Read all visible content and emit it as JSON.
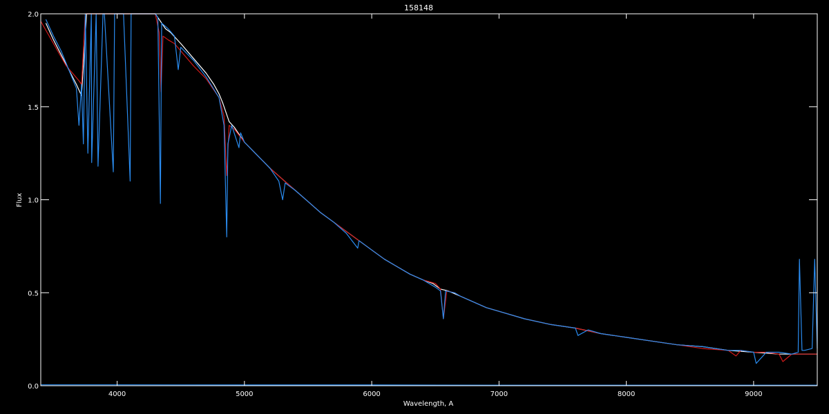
{
  "chart_data": {
    "type": "line",
    "title": "158148",
    "xlabel": "Wavelength, A",
    "ylabel": "Flux",
    "xlim": [
      3400,
      9500
    ],
    "ylim": [
      0.0,
      2.0
    ],
    "x_ticks": [
      4000,
      5000,
      6000,
      7000,
      8000,
      9000
    ],
    "x_tick_labels": [
      "4000",
      "5000",
      "6000",
      "7000",
      "8000",
      "9000"
    ],
    "y_ticks": [
      0.0,
      0.5,
      1.0,
      1.5,
      2.0
    ],
    "y_tick_labels": [
      "0.0",
      "0.5",
      "1.0",
      "1.5",
      "2.0"
    ],
    "grid": false,
    "series": [
      {
        "color": "#ffffff",
        "x": [
          3440,
          3500,
          3560,
          3620,
          3680,
          3720,
          3760,
          3800,
          3850,
          3900,
          3950,
          4000,
          4050,
          4100,
          4150,
          4200,
          4260,
          4300,
          4330,
          4380,
          4420,
          4500,
          4600,
          4700,
          4760,
          4800,
          4830,
          4880,
          4920,
          5000,
          5100,
          5200,
          5300,
          5400,
          5500,
          5600,
          5700,
          5800,
          5900,
          6000,
          6100,
          6200,
          6300,
          6400,
          6480,
          6540,
          6600,
          6700,
          6800,
          6900,
          7000,
          7200,
          7400,
          7600,
          7800,
          8000,
          8200,
          8400,
          8600,
          8800,
          9000,
          9200,
          9400,
          9500
        ],
        "y": [
          1.95,
          1.86,
          1.78,
          1.7,
          1.62,
          1.56,
          2.0,
          2.0,
          2.0,
          2.0,
          2.0,
          2.0,
          2.0,
          2.0,
          2.0,
          2.0,
          2.0,
          2.0,
          1.97,
          1.92,
          1.9,
          1.84,
          1.76,
          1.68,
          1.62,
          1.57,
          1.52,
          1.42,
          1.39,
          1.31,
          1.24,
          1.17,
          1.11,
          1.05,
          0.99,
          0.93,
          0.88,
          0.83,
          0.78,
          0.73,
          0.68,
          0.64,
          0.6,
          0.57,
          0.55,
          0.52,
          0.51,
          0.48,
          0.45,
          0.42,
          0.4,
          0.36,
          0.33,
          0.31,
          0.28,
          0.26,
          0.24,
          0.22,
          0.21,
          0.19,
          0.18,
          0.17,
          0.17,
          0.17
        ]
      },
      {
        "color": "#d21a1a",
        "x": [
          3400,
          3450,
          3500,
          3550,
          3600,
          3650,
          3700,
          3720,
          3750,
          3800,
          3850,
          3900,
          3970,
          4000,
          4050,
          4100,
          4150,
          4200,
          4250,
          4300,
          4330,
          4345,
          4360,
          4400,
          4450,
          4500,
          4600,
          4700,
          4800,
          4840,
          4861,
          4880,
          4920,
          5000,
          5100,
          5200,
          5300,
          5400,
          5500,
          5600,
          5700,
          5800,
          5900,
          6000,
          6100,
          6200,
          6300,
          6400,
          6500,
          6540,
          6563,
          6590,
          6650,
          6700,
          6800,
          6900,
          7000,
          7200,
          7400,
          7600,
          7800,
          8000,
          8200,
          8400,
          8600,
          8800,
          8862,
          8900,
          9000,
          9100,
          9200,
          9230,
          9300,
          9400,
          9500
        ],
        "y": [
          1.96,
          1.9,
          1.84,
          1.78,
          1.72,
          1.68,
          1.64,
          1.62,
          2.0,
          2.0,
          2.0,
          2.0,
          2.0,
          2.0,
          2.0,
          2.0,
          2.0,
          2.0,
          2.0,
          2.0,
          1.9,
          1.58,
          1.88,
          1.86,
          1.84,
          1.8,
          1.72,
          1.65,
          1.55,
          1.45,
          1.13,
          1.4,
          1.38,
          1.31,
          1.24,
          1.17,
          1.11,
          1.05,
          0.99,
          0.93,
          0.88,
          0.83,
          0.78,
          0.73,
          0.68,
          0.64,
          0.6,
          0.57,
          0.55,
          0.52,
          0.36,
          0.51,
          0.5,
          0.48,
          0.45,
          0.42,
          0.4,
          0.36,
          0.33,
          0.31,
          0.28,
          0.26,
          0.24,
          0.22,
          0.2,
          0.19,
          0.16,
          0.19,
          0.18,
          0.18,
          0.17,
          0.13,
          0.17,
          0.17,
          0.17
        ]
      },
      {
        "color": "#2a8cf0",
        "x": [
          3440,
          3500,
          3560,
          3620,
          3680,
          3700,
          3720,
          3735,
          3750,
          3770,
          3797,
          3800,
          3835,
          3850,
          3889,
          3900,
          3970,
          3980,
          4000,
          4050,
          4102,
          4110,
          4150,
          4200,
          4300,
          4320,
          4340,
          4350,
          4400,
          4450,
          4480,
          4500,
          4600,
          4700,
          4800,
          4840,
          4861,
          4870,
          4900,
          4957,
          4970,
          5000,
          5100,
          5200,
          5270,
          5300,
          5320,
          5400,
          5500,
          5600,
          5700,
          5800,
          5890,
          5900,
          6000,
          6100,
          6200,
          6300,
          6400,
          6500,
          6540,
          6563,
          6580,
          6650,
          6700,
          6800,
          6900,
          7000,
          7200,
          7400,
          7600,
          7620,
          7700,
          7800,
          8000,
          8200,
          8400,
          8600,
          8800,
          8900,
          9000,
          9020,
          9100,
          9200,
          9300,
          9350,
          9360,
          9380,
          9400,
          9460,
          9480,
          9500
        ],
        "y": [
          1.97,
          1.88,
          1.8,
          1.7,
          1.6,
          1.4,
          1.62,
          1.3,
          2.0,
          1.25,
          2.0,
          1.2,
          2.0,
          1.18,
          2.0,
          2.0,
          1.15,
          2.0,
          2.0,
          2.0,
          1.1,
          2.0,
          2.0,
          2.0,
          2.0,
          1.98,
          0.98,
          1.95,
          1.92,
          1.88,
          1.7,
          1.82,
          1.75,
          1.66,
          1.55,
          1.4,
          0.8,
          1.3,
          1.4,
          1.28,
          1.36,
          1.31,
          1.24,
          1.17,
          1.1,
          1.0,
          1.09,
          1.05,
          0.99,
          0.93,
          0.88,
          0.82,
          0.74,
          0.78,
          0.73,
          0.68,
          0.64,
          0.6,
          0.57,
          0.53,
          0.51,
          0.36,
          0.51,
          0.5,
          0.48,
          0.45,
          0.42,
          0.4,
          0.36,
          0.33,
          0.31,
          0.27,
          0.3,
          0.28,
          0.26,
          0.24,
          0.22,
          0.21,
          0.19,
          0.19,
          0.18,
          0.12,
          0.18,
          0.18,
          0.17,
          0.18,
          0.68,
          0.19,
          0.19,
          0.2,
          0.68,
          0.2
        ]
      },
      {
        "color": "#2a8cf0",
        "x": [
          3400,
          4000,
          5000,
          6000,
          7000,
          8000,
          9000,
          9500
        ],
        "y": [
          0.005,
          0.005,
          0.004,
          0.004,
          0.003,
          0.003,
          0.003,
          0.003
        ]
      }
    ]
  }
}
